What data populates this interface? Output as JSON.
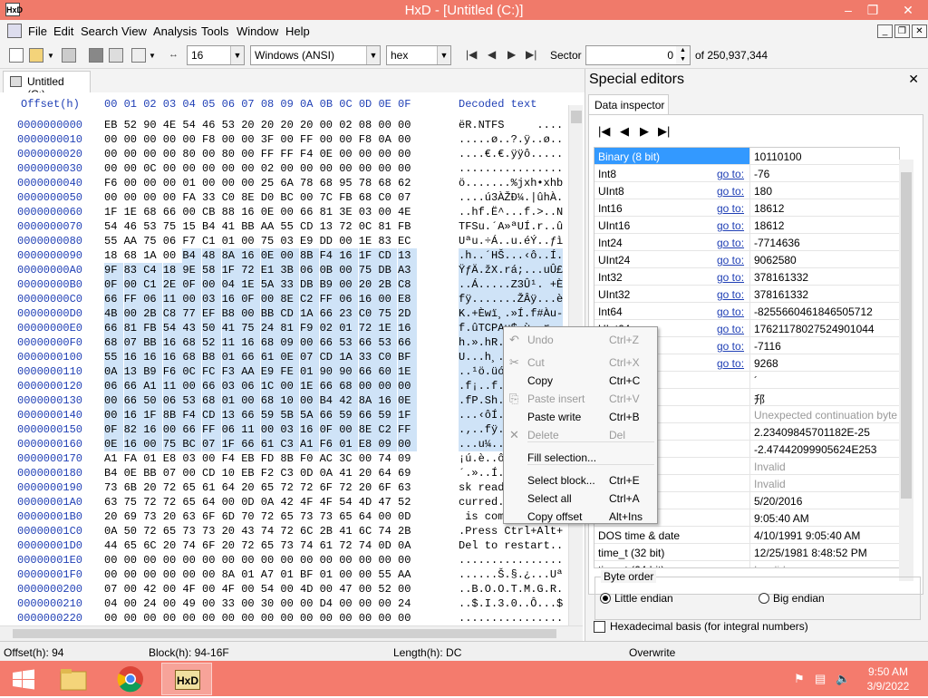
{
  "window": {
    "title": "HxD - [Untitled (C:)]",
    "app_icon": "HxD"
  },
  "menu": [
    "File",
    "Edit",
    "Search",
    "View",
    "Analysis",
    "Tools",
    "Window",
    "Help"
  ],
  "toolbar": {
    "bytes_per_row": "16",
    "charset": "Windows (ANSI)",
    "display": "hex",
    "sector_label": "Sector",
    "sector_value": "0",
    "sector_total": "of 250,937,344"
  },
  "doc_tab": "Untitled (C:)",
  "hex": {
    "header_offset": "Offset(h)",
    "header_cols": "00 01 02 03 04 05 06 07 08 09 0A 0B 0C 0D 0E 0F",
    "header_text": "Decoded text",
    "rows": [
      {
        "off": "0000000000",
        "b": [
          "EB",
          "52",
          "90",
          "4E",
          "54",
          "46",
          "53",
          "20",
          "20",
          "20",
          "20",
          "00",
          "02",
          "08",
          "00",
          "00"
        ],
        "t": "ëR.NTFS     ...."
      },
      {
        "off": "0000000010",
        "b": [
          "00",
          "00",
          "00",
          "00",
          "00",
          "F8",
          "00",
          "00",
          "3F",
          "00",
          "FF",
          "00",
          "00",
          "F8",
          "0A",
          "00"
        ],
        "t": ".....ø..?.ÿ..ø.."
      },
      {
        "off": "0000000020",
        "b": [
          "00",
          "00",
          "00",
          "00",
          "80",
          "00",
          "80",
          "00",
          "FF",
          "FF",
          "F4",
          "0E",
          "00",
          "00",
          "00",
          "00"
        ],
        "t": "....€.€.ÿÿô....."
      },
      {
        "off": "0000000030",
        "b": [
          "00",
          "00",
          "0C",
          "00",
          "00",
          "00",
          "00",
          "00",
          "02",
          "00",
          "00",
          "00",
          "00",
          "00",
          "00",
          "00"
        ],
        "t": "................"
      },
      {
        "off": "0000000040",
        "b": [
          "F6",
          "00",
          "00",
          "00",
          "01",
          "00",
          "00",
          "00",
          "25",
          "6A",
          "78",
          "68",
          "95",
          "78",
          "68",
          "62"
        ],
        "t": "ö.......%jxh•xhb"
      },
      {
        "off": "0000000050",
        "b": [
          "00",
          "00",
          "00",
          "00",
          "FA",
          "33",
          "C0",
          "8E",
          "D0",
          "BC",
          "00",
          "7C",
          "FB",
          "68",
          "C0",
          "07"
        ],
        "t": "....ú3ÀŽĐ¼.|ûhÀ."
      },
      {
        "off": "0000000060",
        "b": [
          "1F",
          "1E",
          "68",
          "66",
          "00",
          "CB",
          "88",
          "16",
          "0E",
          "00",
          "66",
          "81",
          "3E",
          "03",
          "00",
          "4E"
        ],
        "t": "..hf.Ë^...f.>..N"
      },
      {
        "off": "0000000070",
        "b": [
          "54",
          "46",
          "53",
          "75",
          "15",
          "B4",
          "41",
          "BB",
          "AA",
          "55",
          "CD",
          "13",
          "72",
          "0C",
          "81",
          "FB"
        ],
        "t": "TFSu.´A»ªUÍ.r..û"
      },
      {
        "off": "0000000080",
        "b": [
          "55",
          "AA",
          "75",
          "06",
          "F7",
          "C1",
          "01",
          "00",
          "75",
          "03",
          "E9",
          "DD",
          "00",
          "1E",
          "83",
          "EC"
        ],
        "t": "Uªu.÷Á..u.éÝ..ƒì"
      },
      {
        "off": "0000000090",
        "b": [
          "18",
          "68",
          "1A",
          "00",
          "B4",
          "48",
          "8A",
          "16",
          "0E",
          "00",
          "8B",
          "F4",
          "16",
          "1F",
          "CD",
          "13"
        ],
        "t": ".h..´HŠ...‹ô..Í."
      },
      {
        "off": "00000000A0",
        "b": [
          "9F",
          "83",
          "C4",
          "18",
          "9E",
          "58",
          "1F",
          "72",
          "E1",
          "3B",
          "06",
          "0B",
          "00",
          "75",
          "DB",
          "A3"
        ],
        "t": "ŸƒÄ.žX.rá;...uÛ£"
      },
      {
        "off": "00000000B0",
        "b": [
          "0F",
          "00",
          "C1",
          "2E",
          "0F",
          "00",
          "04",
          "1E",
          "5A",
          "33",
          "DB",
          "B9",
          "00",
          "20",
          "2B",
          "C8"
        ],
        "t": "..Á.....Z3Û¹. +È"
      },
      {
        "off": "00000000C0",
        "b": [
          "66",
          "FF",
          "06",
          "11",
          "00",
          "03",
          "16",
          "0F",
          "00",
          "8E",
          "C2",
          "FF",
          "06",
          "16",
          "00",
          "E8"
        ],
        "t": "fÿ.......ŽÂÿ...è"
      },
      {
        "off": "00000000D0",
        "b": [
          "4B",
          "00",
          "2B",
          "C8",
          "77",
          "EF",
          "B8",
          "00",
          "BB",
          "CD",
          "1A",
          "66",
          "23",
          "C0",
          "75",
          "2D"
        ],
        "t": "K.+Èwï¸.»Í.f#Àu-"
      },
      {
        "off": "00000000E0",
        "b": [
          "66",
          "81",
          "FB",
          "54",
          "43",
          "50",
          "41",
          "75",
          "24",
          "81",
          "F9",
          "02",
          "01",
          "72",
          "1E",
          "16"
        ],
        "t": "f.ûTCPAu$.ù..r.."
      },
      {
        "off": "00000000F0",
        "b": [
          "68",
          "07",
          "BB",
          "16",
          "68",
          "52",
          "11",
          "16",
          "68",
          "09",
          "00",
          "66",
          "53",
          "66",
          "53",
          "66"
        ],
        "t": "h.».hR..h..fSfSf"
      },
      {
        "off": "0000000100",
        "b": [
          "55",
          "16",
          "16",
          "16",
          "68",
          "B8",
          "01",
          "66",
          "61",
          "0E",
          "07",
          "CD",
          "1A",
          "33",
          "C0",
          "BF"
        ],
        "t": "U...h¸.fa..Í.3À¿"
      },
      {
        "off": "0000000110",
        "b": [
          "0A",
          "13",
          "B9",
          "F6",
          "0C",
          "FC",
          "F3",
          "AA",
          "E9",
          "FE",
          "01",
          "90",
          "90",
          "66",
          "60",
          "1E"
        ],
        "t": "..¹ö.üóªéþ..f`.."
      },
      {
        "off": "0000000120",
        "b": [
          "06",
          "66",
          "A1",
          "11",
          "00",
          "66",
          "03",
          "06",
          "1C",
          "00",
          "1E",
          "66",
          "68",
          "00",
          "00",
          "00"
        ],
        "t": ".f¡..f....fh...."
      },
      {
        "off": "0000000130",
        "b": [
          "00",
          "66",
          "50",
          "06",
          "53",
          "68",
          "01",
          "00",
          "68",
          "10",
          "00",
          "B4",
          "42",
          "8A",
          "16",
          "0E"
        ],
        "t": ".fP.Sh..h..´BŠ.."
      },
      {
        "off": "0000000140",
        "b": [
          "00",
          "16",
          "1F",
          "8B",
          "F4",
          "CD",
          "13",
          "66",
          "59",
          "5B",
          "5A",
          "66",
          "59",
          "66",
          "59",
          "1F"
        ],
        "t": "...‹ôÍ.fY[ZfYfY."
      },
      {
        "off": "0000000150",
        "b": [
          "0F",
          "82",
          "16",
          "00",
          "66",
          "FF",
          "06",
          "11",
          "00",
          "03",
          "16",
          "0F",
          "00",
          "8E",
          "C2",
          "FF"
        ],
        "t": ".‚..fÿ......ŽÂÿ"
      },
      {
        "off": "0000000160",
        "b": [
          "0E",
          "16",
          "00",
          "75",
          "BC",
          "07",
          "1F",
          "66",
          "61",
          "C3",
          "A1",
          "F6",
          "01",
          "E8",
          "09",
          "00"
        ],
        "t": "...u¼..faÃ¡ö.è.."
      },
      {
        "off": "0000000170",
        "b": [
          "A1",
          "FA",
          "01",
          "E8",
          "03",
          "00",
          "F4",
          "EB",
          "FD",
          "8B",
          "F0",
          "AC",
          "3C",
          "00",
          "74",
          "09"
        ],
        "t": "¡ú.è..ôëý‹ð¬<.t."
      },
      {
        "off": "0000000180",
        "b": [
          "B4",
          "0E",
          "BB",
          "07",
          "00",
          "CD",
          "10",
          "EB",
          "F2",
          "C3",
          "0D",
          "0A",
          "41",
          "20",
          "64",
          "69"
        ],
        "t": "´.»..Í.ëòÃ..A di"
      },
      {
        "off": "0000000190",
        "b": [
          "73",
          "6B",
          "20",
          "72",
          "65",
          "61",
          "64",
          "20",
          "65",
          "72",
          "72",
          "6F",
          "72",
          "20",
          "6F",
          "63"
        ],
        "t": "sk read error oc"
      },
      {
        "off": "00000001A0",
        "b": [
          "63",
          "75",
          "72",
          "72",
          "65",
          "64",
          "00",
          "0D",
          "0A",
          "42",
          "4F",
          "4F",
          "54",
          "4D",
          "47",
          "52"
        ],
        "t": "curred..BOOTMGR"
      },
      {
        "off": "00000001B0",
        "b": [
          "20",
          "69",
          "73",
          "20",
          "63",
          "6F",
          "6D",
          "70",
          "72",
          "65",
          "73",
          "73",
          "65",
          "64",
          "00",
          "0D"
        ],
        "t": " is compressed.."
      },
      {
        "off": "00000001C0",
        "b": [
          "0A",
          "50",
          "72",
          "65",
          "73",
          "73",
          "20",
          "43",
          "74",
          "72",
          "6C",
          "2B",
          "41",
          "6C",
          "74",
          "2B"
        ],
        "t": ".Press Ctrl+Alt+"
      },
      {
        "off": "00000001D0",
        "b": [
          "44",
          "65",
          "6C",
          "20",
          "74",
          "6F",
          "20",
          "72",
          "65",
          "73",
          "74",
          "61",
          "72",
          "74",
          "0D",
          "0A"
        ],
        "t": "Del to restart.."
      },
      {
        "off": "00000001E0",
        "b": [
          "00",
          "00",
          "00",
          "00",
          "00",
          "00",
          "00",
          "00",
          "00",
          "00",
          "00",
          "00",
          "00",
          "00",
          "00",
          "00"
        ],
        "t": "................"
      },
      {
        "off": "00000001F0",
        "b": [
          "00",
          "00",
          "00",
          "00",
          "00",
          "00",
          "8A",
          "01",
          "A7",
          "01",
          "BF",
          "01",
          "00",
          "00",
          "55",
          "AA"
        ],
        "t": "......Š.§.¿...Uª"
      },
      {
        "off": "0000000200",
        "b": [
          "07",
          "00",
          "42",
          "00",
          "4F",
          "00",
          "4F",
          "00",
          "54",
          "00",
          "4D",
          "00",
          "47",
          "00",
          "52",
          "00"
        ],
        "t": "..B.O.O.T.M.G.R."
      },
      {
        "off": "0000000210",
        "b": [
          "04",
          "00",
          "24",
          "00",
          "49",
          "00",
          "33",
          "00",
          "30",
          "00",
          "00",
          "D4",
          "00",
          "00",
          "00",
          "24"
        ],
        "t": "..$.I.3.0..Ô...$"
      },
      {
        "off": "0000000220",
        "b": [
          "00",
          "00",
          "00",
          "00",
          "00",
          "00",
          "00",
          "00",
          "00",
          "00",
          "00",
          "00",
          "00",
          "00",
          "00",
          "00"
        ],
        "t": "................"
      }
    ]
  },
  "special_editors": {
    "title": "Special editors",
    "tab": "Data inspector"
  },
  "inspector": [
    {
      "name": "Binary (8 bit)",
      "goto": "",
      "value": "10110100"
    },
    {
      "name": "Int8",
      "goto": "go to:",
      "value": "-76"
    },
    {
      "name": "UInt8",
      "goto": "go to:",
      "value": "180"
    },
    {
      "name": "Int16",
      "goto": "go to:",
      "value": "18612"
    },
    {
      "name": "UInt16",
      "goto": "go to:",
      "value": "18612"
    },
    {
      "name": "Int24",
      "goto": "go to:",
      "value": "-7714636"
    },
    {
      "name": "UInt24",
      "goto": "go to:",
      "value": "9062580"
    },
    {
      "name": "Int32",
      "goto": "go to:",
      "value": "378161332"
    },
    {
      "name": "UInt32",
      "goto": "go to:",
      "value": "378161332"
    },
    {
      "name": "Int64",
      "goto": "go to:",
      "value": "-8255660461846505712"
    },
    {
      "name": "UInt64",
      "goto": "go to:",
      "value": "17621178027524901044"
    },
    {
      "name": "",
      "goto": "go to:",
      "value": "-7116"
    },
    {
      "name": "",
      "goto": "go to:",
      "value": "9268"
    },
    {
      "name": "har8_t",
      "goto": "",
      "value": "´"
    },
    {
      "name": "har16_t",
      "goto": "",
      "value": "䢴"
    },
    {
      "name": "point",
      "goto": "",
      "value": "Unexpected continuation byte"
    },
    {
      "name": "2)",
      "goto": "",
      "value": "2.23409845701182E-25"
    },
    {
      "name": "64)",
      "goto": "",
      "value": "-2.47442099905624E253"
    },
    {
      "name": "",
      "goto": "",
      "value": "Invalid"
    },
    {
      "name": "",
      "goto": "",
      "value": "Invalid"
    },
    {
      "name": "",
      "goto": "",
      "value": "5/20/2016"
    },
    {
      "name": "",
      "goto": "",
      "value": "9:05:40 AM"
    },
    {
      "name": "DOS time & date",
      "goto": "",
      "value": "4/10/1991 9:05:40 AM"
    },
    {
      "name": "time_t (32 bit)",
      "goto": "",
      "value": "12/25/1981 8:48:52 PM"
    },
    {
      "name": "time_t (64 bit)",
      "goto": "",
      "value": "Invalid"
    }
  ],
  "byte_order": {
    "label": "Byte order",
    "little": "Little endian",
    "big": "Big endian"
  },
  "hex_basis": "Hexadecimal basis (for integral numbers)",
  "context_menu": [
    {
      "label": "Undo",
      "key": "Ctrl+Z",
      "enabled": false
    },
    {
      "label": "Cut",
      "key": "Ctrl+X",
      "enabled": false
    },
    {
      "label": "Copy",
      "key": "Ctrl+C",
      "enabled": true
    },
    {
      "label": "Paste insert",
      "key": "Ctrl+V",
      "enabled": false
    },
    {
      "label": "Paste write",
      "key": "Ctrl+B",
      "enabled": true
    },
    {
      "label": "Delete",
      "key": "Del",
      "enabled": false
    },
    {
      "label": "Fill selection...",
      "key": "",
      "enabled": true
    },
    {
      "label": "Select block...",
      "key": "Ctrl+E",
      "enabled": true
    },
    {
      "label": "Select all",
      "key": "Ctrl+A",
      "enabled": true
    },
    {
      "label": "Copy offset",
      "key": "Alt+Ins",
      "enabled": true
    }
  ],
  "status": {
    "offset": "Offset(h): 94",
    "block": "Block(h): 94-16F",
    "length": "Length(h): DC",
    "mode": "Overwrite"
  },
  "clock": {
    "time": "9:50 AM",
    "date": "3/9/2022"
  },
  "colors": {
    "titlebar": "#f07a6a",
    "taskbar": "#f47b6d",
    "selection": "#cfe3f7",
    "offset_blue": "#1f3fb5"
  }
}
